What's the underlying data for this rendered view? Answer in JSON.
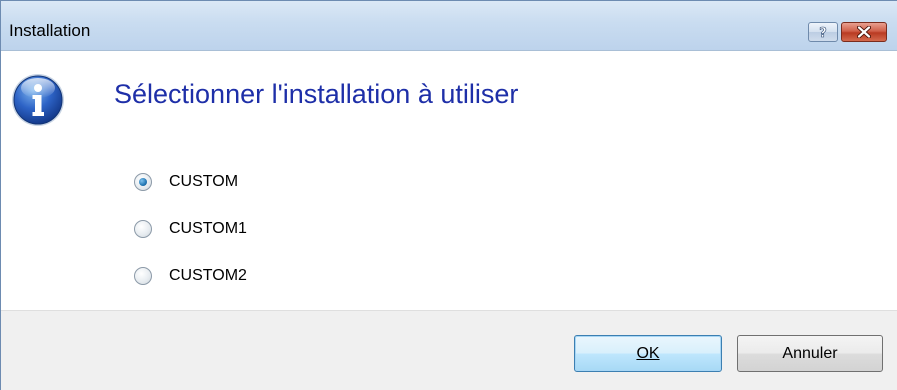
{
  "window": {
    "title": "Installation",
    "help_glyph": "?",
    "close_glyph": "✕"
  },
  "dialog": {
    "heading": "Sélectionner l'installation à utiliser",
    "icon": "info-icon",
    "accent_color": "#1e2fa8"
  },
  "options": [
    {
      "label": "CUSTOM",
      "selected": true
    },
    {
      "label": "CUSTOM1",
      "selected": false
    },
    {
      "label": "CUSTOM2",
      "selected": false
    }
  ],
  "buttons": {
    "ok_label": "OK",
    "cancel_label": "Annuler"
  }
}
